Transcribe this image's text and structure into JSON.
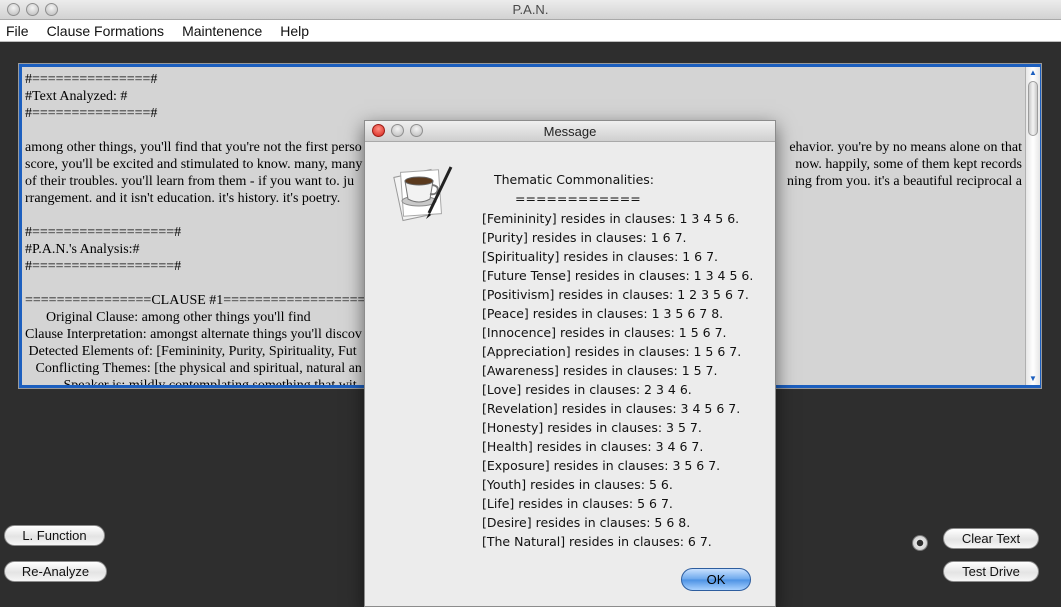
{
  "window": {
    "title": "P.A.N."
  },
  "menu": [
    "File",
    "Clause Formations",
    "Maintenence",
    "Help"
  ],
  "text_area": {
    "lines": [
      "#===============#",
      "#Text Analyzed: #",
      "#===============#",
      "",
      "among other things, you'll find that you're not the first perso",
      "score, you'll be excited and stimulated to know. many, many",
      "of their troubles. you'll learn from them - if you want to. ju",
      "rrangement. and it isn't education. it's history. it's poetry.",
      "",
      "#==================#",
      "#P.A.N.'s Analysis:#",
      "#==================#",
      "",
      "================CLAUSE #1==================",
      "      Original Clause: among other things you'll find",
      "Clause Interpretation: amongst alternate things you'll discov",
      " Detected Elements of: [Femininity, Purity, Spirituality, Fut",
      "   Conflicting Themes: [the physical and spiritual, natural an",
      "           Speaker is: mildly contemplating something that wit"
    ],
    "right_fragments": {
      "line4": "ehavior. you're by no means alone on that",
      "line5": "now. happily, some of them kept records",
      "line6": "ning from you. it's a beautiful reciprocal a"
    }
  },
  "buttons": {
    "l_function": "L. Function",
    "re_analyze": "Re-Analyze",
    "clear_text": "Clear Text",
    "test_drive": "Test Drive"
  },
  "dialog": {
    "title": "Message",
    "heading": "Thematic Commonalities:",
    "rule": "============",
    "rows": [
      "[Femininity] resides in clauses: 1 3 4 5 6.",
      "[Purity] resides in clauses: 1 6 7.",
      "[Spirituality] resides in clauses: 1 6 7.",
      "[Future Tense] resides in clauses: 1 3 4 5 6.",
      "[Positivism] resides in clauses: 1 2 3 5 6 7.",
      "[Peace] resides in clauses: 1 3 5 6 7 8.",
      "[Innocence] resides in clauses: 1 5 6 7.",
      "[Appreciation] resides in clauses: 1 5 6 7.",
      "[Awareness] resides in clauses: 1 5 7.",
      "[Love] resides in clauses: 2 3 4 6.",
      "[Revelation] resides in clauses: 3 4 5 6 7.",
      "[Honesty] resides in clauses: 3 5 7.",
      "[Health] resides in clauses: 3 4 6 7.",
      "[Exposure] resides in clauses: 3 5 6 7.",
      "[Youth] resides in clauses: 5 6.",
      "[Life] resides in clauses: 5 6 7.",
      "[Desire] resides in clauses: 5 6 8.",
      "[The Natural] resides in clauses: 6 7."
    ],
    "ok_label": "OK",
    "icon": "coffee-cup-pen-icon"
  },
  "colors": {
    "focus_ring": "#1c5fbf",
    "background": "#2e2e2e",
    "text_bg": "#d4d4d4",
    "close_red": "#d6221a"
  }
}
